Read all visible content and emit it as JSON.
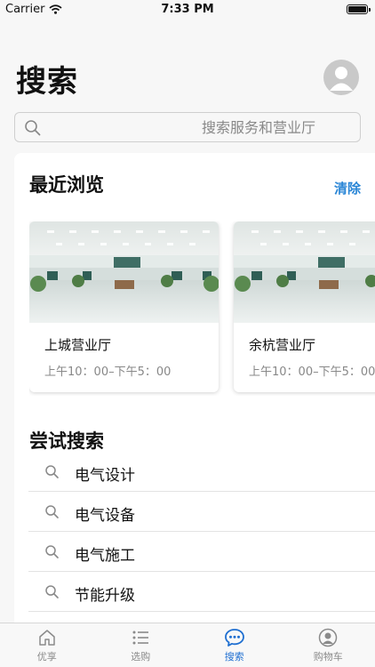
{
  "status_bar": {
    "carrier": "Carrier",
    "time": "7:33 PM"
  },
  "header": {
    "title": "搜索"
  },
  "search": {
    "placeholder": "搜索服务和营业厅"
  },
  "recent": {
    "title": "最近浏览",
    "clear_label": "清除",
    "cards": [
      {
        "name": "上城营业厅",
        "hours": "上午10：00–下午5：00"
      },
      {
        "name": "余杭营业厅",
        "hours": "上午10：00–下午5：00"
      }
    ]
  },
  "try_search": {
    "title": "尝试搜索",
    "items": [
      "电气设计",
      "电气设备",
      "电气施工",
      "节能升级"
    ]
  },
  "tab_bar": {
    "tabs": [
      {
        "label": "优享",
        "icon": "home-icon"
      },
      {
        "label": "选购",
        "icon": "list-icon"
      },
      {
        "label": "搜索",
        "icon": "chat-icon"
      },
      {
        "label": "购物车",
        "icon": "person-icon"
      }
    ],
    "active_index": 2
  },
  "colors": {
    "accent": "#1f6fd1",
    "link": "#2a86d6"
  }
}
